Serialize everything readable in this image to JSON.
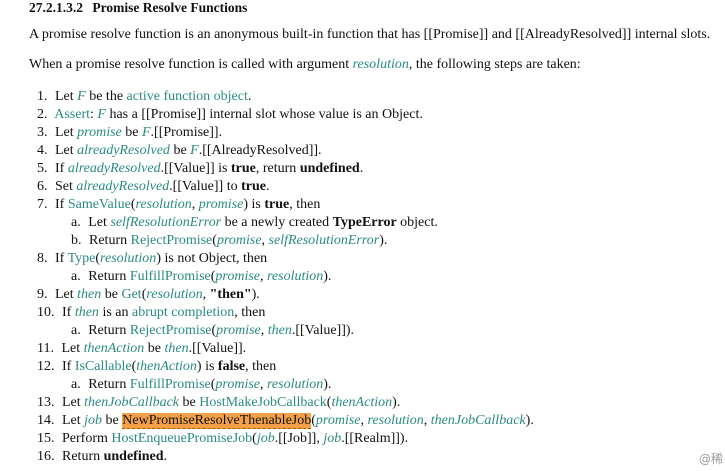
{
  "section": {
    "number": "27.2.1.3.2",
    "title": "Promise Resolve Functions"
  },
  "intro": {
    "line1": "A promise resolve function is an anonymous built-in function that has [[Promise]] and [[AlreadyResolved]] internal slots.",
    "line2_before": "When a promise resolve function is called with argument ",
    "line2_arg": "resolution",
    "line2_after": ", the following steps are taken:"
  },
  "steps": [
    [
      {
        "t": "1."
      },
      {
        "t": " Let "
      },
      {
        "v": "F"
      },
      {
        "t": " be the "
      },
      {
        "l": "active function object"
      },
      {
        "t": "."
      }
    ],
    [
      {
        "t": "2."
      },
      {
        "t": " "
      },
      {
        "l": "Assert"
      },
      {
        "t": ": "
      },
      {
        "v": "F"
      },
      {
        "t": " has a [[Promise]] internal slot whose value is an Object."
      }
    ],
    [
      {
        "t": "3."
      },
      {
        "t": " Let "
      },
      {
        "v": "promise"
      },
      {
        "t": " be "
      },
      {
        "v": "F"
      },
      {
        "t": ".[[Promise]]."
      }
    ],
    [
      {
        "t": "4."
      },
      {
        "t": " Let "
      },
      {
        "v": "alreadyResolved"
      },
      {
        "t": " be "
      },
      {
        "v": "F"
      },
      {
        "t": ".[[AlreadyResolved]]."
      }
    ],
    [
      {
        "t": "5."
      },
      {
        "t": " If "
      },
      {
        "v": "alreadyResolved"
      },
      {
        "t": ".[[Value]] is "
      },
      {
        "b": "true"
      },
      {
        "t": ", return "
      },
      {
        "b": "undefined"
      },
      {
        "t": "."
      }
    ],
    [
      {
        "t": "6."
      },
      {
        "t": " Set "
      },
      {
        "v": "alreadyResolved"
      },
      {
        "t": ".[[Value]] to "
      },
      {
        "b": "true"
      },
      {
        "t": "."
      }
    ],
    [
      {
        "t": "7."
      },
      {
        "t": " If "
      },
      {
        "l": "SameValue"
      },
      {
        "t": "("
      },
      {
        "v": "resolution"
      },
      {
        "t": ", "
      },
      {
        "v": "promise"
      },
      {
        "t": ") is "
      },
      {
        "b": "true"
      },
      {
        "t": ", then"
      }
    ],
    [
      {
        "t": "a."
      },
      {
        "t": " Let "
      },
      {
        "v": "selfResolutionError"
      },
      {
        "t": " be a newly created "
      },
      {
        "b": "TypeError"
      },
      {
        "t": " object."
      }
    ],
    [
      {
        "t": "b."
      },
      {
        "t": " Return "
      },
      {
        "l": "RejectPromise"
      },
      {
        "t": "("
      },
      {
        "v": "promise"
      },
      {
        "t": ", "
      },
      {
        "v": "selfResolutionError"
      },
      {
        "t": ")."
      }
    ],
    [
      {
        "t": "8."
      },
      {
        "t": " If "
      },
      {
        "l": "Type"
      },
      {
        "t": "("
      },
      {
        "v": "resolution"
      },
      {
        "t": ") is not Object, then"
      }
    ],
    [
      {
        "t": "a."
      },
      {
        "t": " Return "
      },
      {
        "l": "FulfillPromise"
      },
      {
        "t": "("
      },
      {
        "v": "promise"
      },
      {
        "t": ", "
      },
      {
        "v": "resolution"
      },
      {
        "t": ")."
      }
    ],
    [
      {
        "t": "9."
      },
      {
        "t": " Let "
      },
      {
        "v": "then"
      },
      {
        "t": " be "
      },
      {
        "l": "Get"
      },
      {
        "t": "("
      },
      {
        "v": "resolution"
      },
      {
        "t": ", "
      },
      {
        "b": "\"then\""
      },
      {
        "t": ")."
      }
    ],
    [
      {
        "t": "10."
      },
      {
        "t": " If "
      },
      {
        "v": "then"
      },
      {
        "t": " is an "
      },
      {
        "l": "abrupt completion"
      },
      {
        "t": ", then"
      }
    ],
    [
      {
        "t": "a."
      },
      {
        "t": " Return "
      },
      {
        "l": "RejectPromise"
      },
      {
        "t": "("
      },
      {
        "v": "promise"
      },
      {
        "t": ", "
      },
      {
        "v": "then"
      },
      {
        "t": ".[[Value]])."
      }
    ],
    [
      {
        "t": "11."
      },
      {
        "t": " Let "
      },
      {
        "v": "thenAction"
      },
      {
        "t": " be "
      },
      {
        "v": "then"
      },
      {
        "t": ".[[Value]]."
      }
    ],
    [
      {
        "t": "12."
      },
      {
        "t": " If "
      },
      {
        "l": "IsCallable"
      },
      {
        "t": "("
      },
      {
        "v": "thenAction"
      },
      {
        "t": ") is "
      },
      {
        "b": "false"
      },
      {
        "t": ", then"
      }
    ],
    [
      {
        "t": "a."
      },
      {
        "t": " Return "
      },
      {
        "l": "FulfillPromise"
      },
      {
        "t": "("
      },
      {
        "v": "promise"
      },
      {
        "t": ", "
      },
      {
        "v": "resolution"
      },
      {
        "t": ")."
      }
    ],
    [
      {
        "t": "13."
      },
      {
        "t": " Let "
      },
      {
        "v": "thenJobCallback"
      },
      {
        "t": " be "
      },
      {
        "l": "HostMakeJobCallback"
      },
      {
        "t": "("
      },
      {
        "v": "thenAction"
      },
      {
        "t": ")."
      }
    ],
    [
      {
        "t": "14."
      },
      {
        "t": " Let "
      },
      {
        "v": "job"
      },
      {
        "t": " be "
      },
      {
        "h": "NewPromiseResolveThenableJob"
      },
      {
        "t": "("
      },
      {
        "v": "promise"
      },
      {
        "t": ", "
      },
      {
        "v": "resolution"
      },
      {
        "t": ", "
      },
      {
        "v": "thenJobCallback"
      },
      {
        "t": ")."
      }
    ],
    [
      {
        "t": "15."
      },
      {
        "t": " Perform "
      },
      {
        "l": "HostEnqueuePromiseJob"
      },
      {
        "t": "("
      },
      {
        "v": "job"
      },
      {
        "t": ".[[Job]], "
      },
      {
        "v": "job"
      },
      {
        "t": ".[[Realm]])."
      }
    ],
    [
      {
        "t": "16."
      },
      {
        "t": " Return "
      },
      {
        "b": "undefined"
      },
      {
        "t": "."
      }
    ]
  ],
  "watermark": "@稀"
}
